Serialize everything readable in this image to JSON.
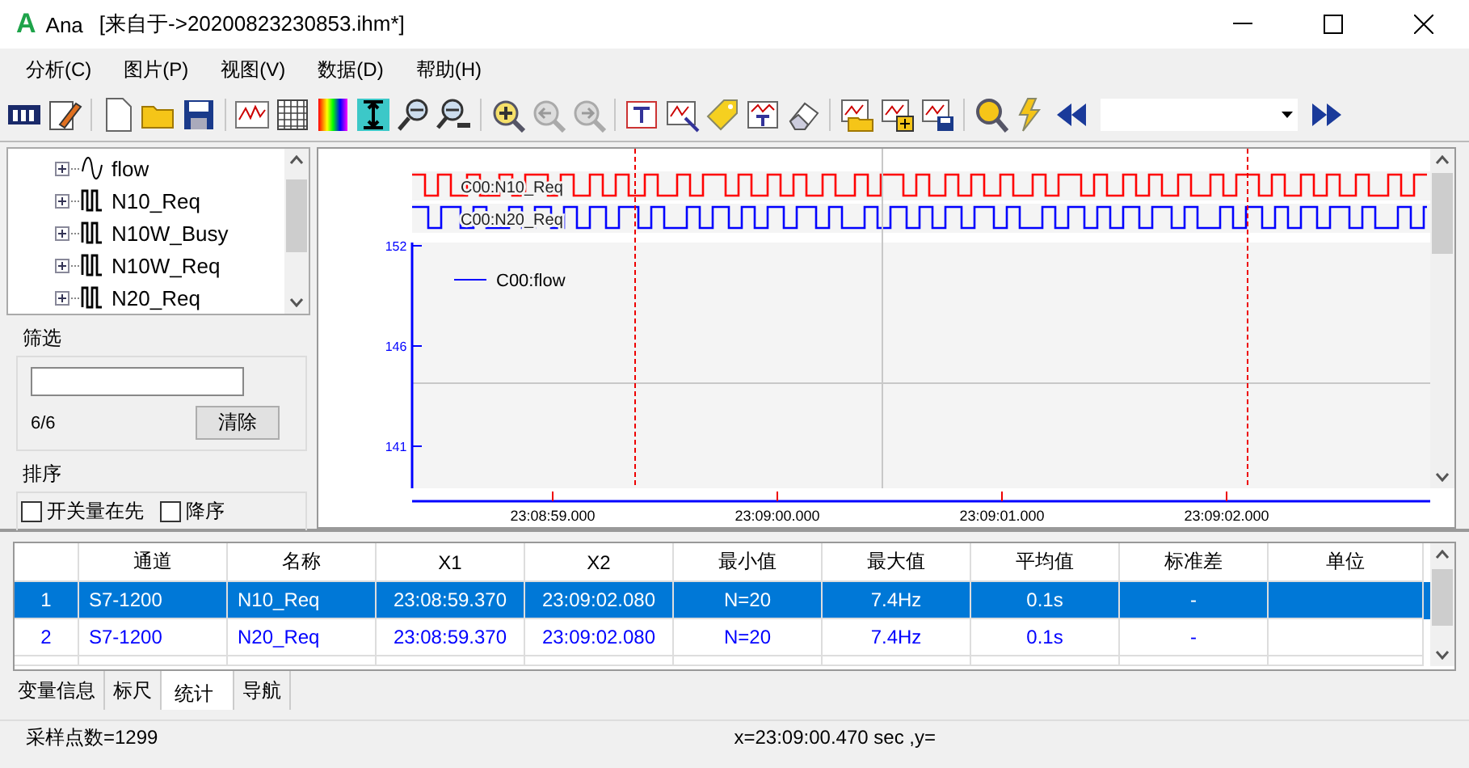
{
  "window": {
    "logo": "A",
    "app_name": "Ana",
    "title": "[来自于->20200823230853.ihm*]"
  },
  "menu": [
    "分析(C)",
    "图片(P)",
    "视图(V)",
    "数据(D)",
    "帮助(H)"
  ],
  "tree": {
    "items": [
      {
        "label": "flow",
        "kind": "analog"
      },
      {
        "label": "N10_Req",
        "kind": "digital"
      },
      {
        "label": "N10W_Busy",
        "kind": "digital"
      },
      {
        "label": "N10W_Req",
        "kind": "digital"
      },
      {
        "label": "N20_Req",
        "kind": "digital"
      }
    ]
  },
  "filter": {
    "title": "筛选",
    "count": "6/6",
    "clear_button": "清除"
  },
  "sort": {
    "title": "排序",
    "options": [
      {
        "label": "开关量在先",
        "checked": false
      },
      {
        "label": "降序",
        "checked": false
      }
    ]
  },
  "plot": {
    "digital_lanes": [
      {
        "label": "C00:N10_Req",
        "color": "#ff0000"
      },
      {
        "label": "C00:N20_Req",
        "color": "#0000ff"
      }
    ],
    "legend": "C00:flow",
    "y_ticks": [
      "152",
      "146",
      "141"
    ],
    "x_ticks": [
      "23:08:59.000",
      "23:09:00.000",
      "23:09:01.000",
      "23:09:02.000"
    ]
  },
  "table": {
    "columns": [
      "通道",
      "名称",
      "X1",
      "X2",
      "最小值",
      "最大值",
      "平均值",
      "标准差",
      "单位"
    ],
    "rows": [
      {
        "index": "1",
        "channel": "S7-1200",
        "name": "N10_Req",
        "x1": "23:08:59.370",
        "x2": "23:09:02.080",
        "min": "N=20",
        "max": "7.4Hz",
        "avg": "0.1s",
        "std": "-",
        "selected": true
      },
      {
        "index": "2",
        "channel": "S7-1200",
        "name": "N20_Req",
        "x1": "23:08:59.370",
        "x2": "23:09:02.080",
        "min": "N=20",
        "max": "7.4Hz",
        "avg": "0.1s",
        "std": "-",
        "selected": false
      }
    ]
  },
  "tabs": [
    {
      "label": "变量信息",
      "selected": false
    },
    {
      "label": "标尺",
      "selected": false
    },
    {
      "label": "统计",
      "selected": true
    },
    {
      "label": "导航",
      "selected": false
    }
  ],
  "status_bar": {
    "samples": "采样点数=1299",
    "cursor": "x=23:09:00.470 sec ,y="
  }
}
